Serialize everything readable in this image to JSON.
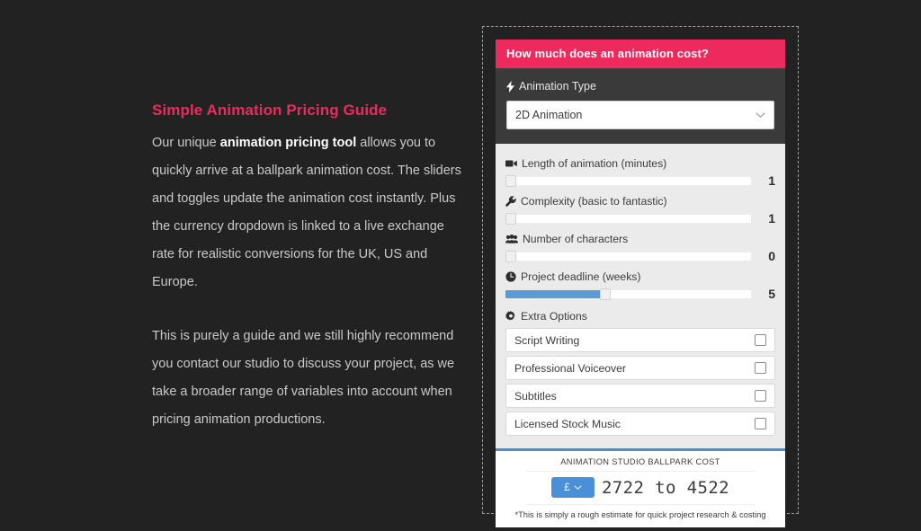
{
  "page": {
    "background_color": "#222222",
    "accent_pink": "#ec2a5e",
    "accent_blue": "#4a90d9"
  },
  "article": {
    "title": "Simple Animation Pricing Guide",
    "paragraph1_part1": "Our unique ",
    "paragraph1_bold": "animation pricing tool",
    "paragraph1_part2": " allows you to quickly arrive at a ballpark animation cost. The sliders and toggles update the animation cost instantly. Plus the currency dropdown is linked to a live exchange rate for realistic conversions for the UK, US and Europe.",
    "paragraph2": "This is purely a guide and we still highly recommend you contact our studio to discuss your project, as we take a broader range of variables into account when pricing animation productions."
  },
  "widget": {
    "header_title": "How much does an animation cost?",
    "animation_type": {
      "icon": "bolt-icon",
      "label": "Animation Type",
      "selected": "2D Animation",
      "chevron": "⌄"
    },
    "sliders": [
      {
        "icon": "video-camera-icon",
        "label": "Length of animation (minutes)",
        "value": "1",
        "fill_percent": 0
      },
      {
        "icon": "wrench-icon",
        "label": "Complexity (basic to fantastic)",
        "value": "1",
        "fill_percent": 0
      },
      {
        "icon": "users-icon",
        "label": "Number of characters",
        "value": "0",
        "fill_percent": 0
      },
      {
        "icon": "clock-icon",
        "label": "Project deadline (weeks)",
        "value": "5",
        "fill_percent": 40
      }
    ],
    "extra_options": {
      "icon": "gear-icon",
      "label": "Extra Options",
      "items": [
        {
          "label": "Script Writing",
          "checked": false
        },
        {
          "label": "Professional Voiceover",
          "checked": false
        },
        {
          "label": "Subtitles",
          "checked": false
        },
        {
          "label": "Licensed Stock Music",
          "checked": false
        }
      ]
    },
    "result": {
      "title": "ANIMATION STUDIO BALLPARK COST",
      "currency_symbol": "£",
      "currency_chevron": "⌄",
      "amount": "2722 to 4522",
      "footnote": "*This is simply a rough estimate for quick project research & costing"
    }
  }
}
